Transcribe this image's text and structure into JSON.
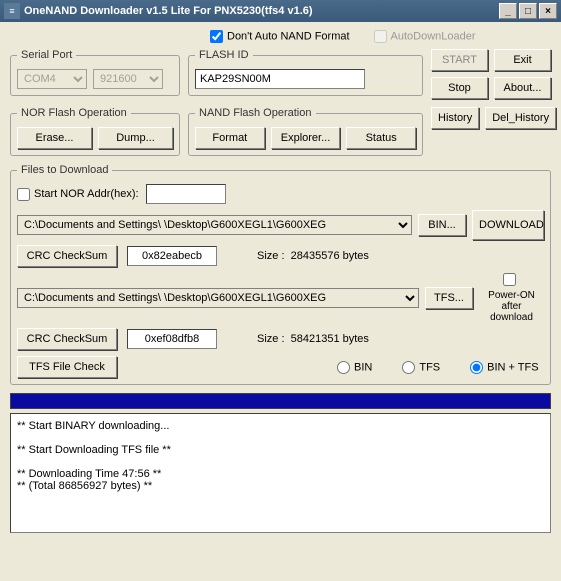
{
  "window": {
    "title": "OneNAND Downloader v1.5 Lite For PNX5230(tfs4 v1.6)"
  },
  "checks": {
    "dont_auto_nand": "Don't Auto NAND Format",
    "auto_downloader": "AutoDownLoader"
  },
  "serial": {
    "legend": "Serial Port",
    "port": "COM4",
    "baud": "921600"
  },
  "flashid": {
    "legend": "FLASH ID",
    "value": "KAP29SN00M"
  },
  "btns": {
    "start": "START",
    "exit": "Exit",
    "stop": "Stop",
    "about": "About...",
    "history": "History",
    "del_history": "Del_History",
    "download": "DOWNLOAD",
    "bin": "BIN...",
    "tfs": "TFS...",
    "erase": "Erase...",
    "dump": "Dump...",
    "format": "Format",
    "explorer": "Explorer...",
    "status": "Status",
    "crc": "CRC CheckSum",
    "tfscheck": "TFS File Check"
  },
  "nor": {
    "legend": "NOR Flash Operation"
  },
  "nand": {
    "legend": "NAND Flash Operation"
  },
  "files": {
    "legend": "Files to Download",
    "start_nor_addr": "Start NOR Addr(hex):",
    "path1": "C:\\Documents and Settings\\                      \\Desktop\\G600XEGL1\\G600XEG",
    "crc1": "0x82eabecb",
    "size1_label": "Size :",
    "size1": "28435576  bytes",
    "path2": "C:\\Documents and Settings\\                      \\Desktop\\G600XEGL1\\G600XEG",
    "crc2": "0xef08dfb8",
    "size2_label": "Size :",
    "size2": "58421351  bytes",
    "power_on": "Power-ON after download",
    "r_bin": "BIN",
    "r_tfs": "TFS",
    "r_bintfs": "BIN + TFS"
  },
  "log": "** Start BINARY downloading...\n\n** Start Downloading TFS file **\n\n** Downloading Time 47:56 **\n** (Total 86856927 bytes) **"
}
